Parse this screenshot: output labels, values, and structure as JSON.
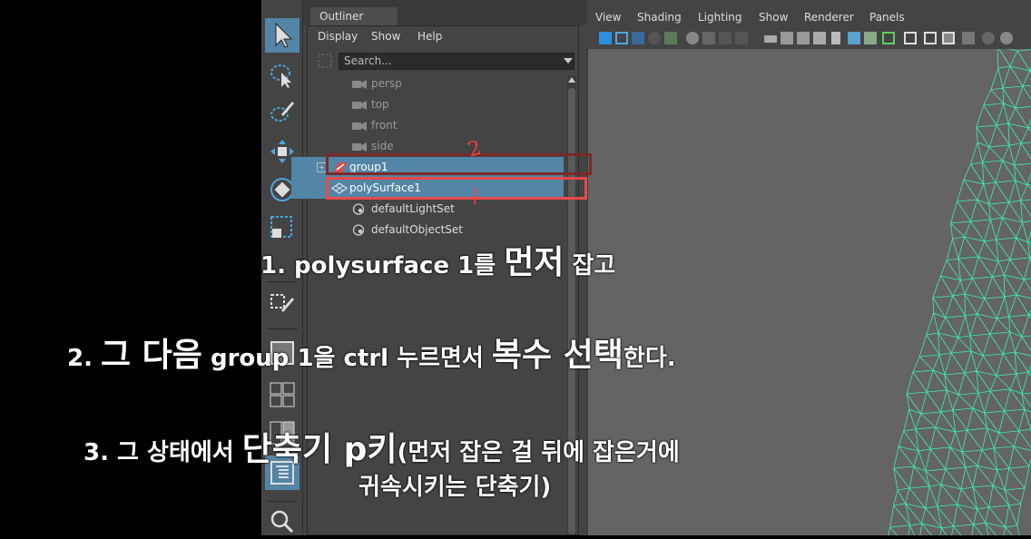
{
  "outliner": {
    "tab_title": "Outliner",
    "menus": [
      "Display",
      "Show",
      "Help"
    ],
    "search_placeholder": "Search...",
    "items": [
      {
        "label": "persp",
        "icon": "camera-icon"
      },
      {
        "label": "top",
        "icon": "camera-icon"
      },
      {
        "label": "front",
        "icon": "camera-icon"
      },
      {
        "label": "side",
        "icon": "camera-icon"
      },
      {
        "label": "group1",
        "icon": "group-transform-icon",
        "selected": true
      },
      {
        "label": "polySurface1",
        "icon": "poly-mesh-icon",
        "selected": true
      },
      {
        "label": "defaultLightSet",
        "icon": "set-icon"
      },
      {
        "label": "defaultObjectSet",
        "icon": "set-icon"
      }
    ]
  },
  "viewport": {
    "menus": [
      "View",
      "Shading",
      "Lighting",
      "Show",
      "Renderer",
      "Panels"
    ]
  },
  "annotations": {
    "line1_a": "1. polysurface 1를 ",
    "line1_b": "먼저",
    "line1_c": " 잡고",
    "line2_a": "2. ",
    "line2_b": "그 다음",
    "line2_c": " group 1을 ctrl 누르면서 ",
    "line2_d": "복수 선택",
    "line2_e": "한다.",
    "line3_a": "3. 그 상태에서 ",
    "line3_b": "단축기 p키",
    "line3_c": "(먼저 잡은 걸 뒤에 잡은거에",
    "line4": "귀속시키는 단축기)",
    "mark_1": "/",
    "mark_2": "2"
  },
  "colors": {
    "selection": "#5285a6",
    "mark_red": "#e84a4a",
    "mark_dark_red": "#7a2a2a",
    "wireframe": "#3cf0a8"
  }
}
